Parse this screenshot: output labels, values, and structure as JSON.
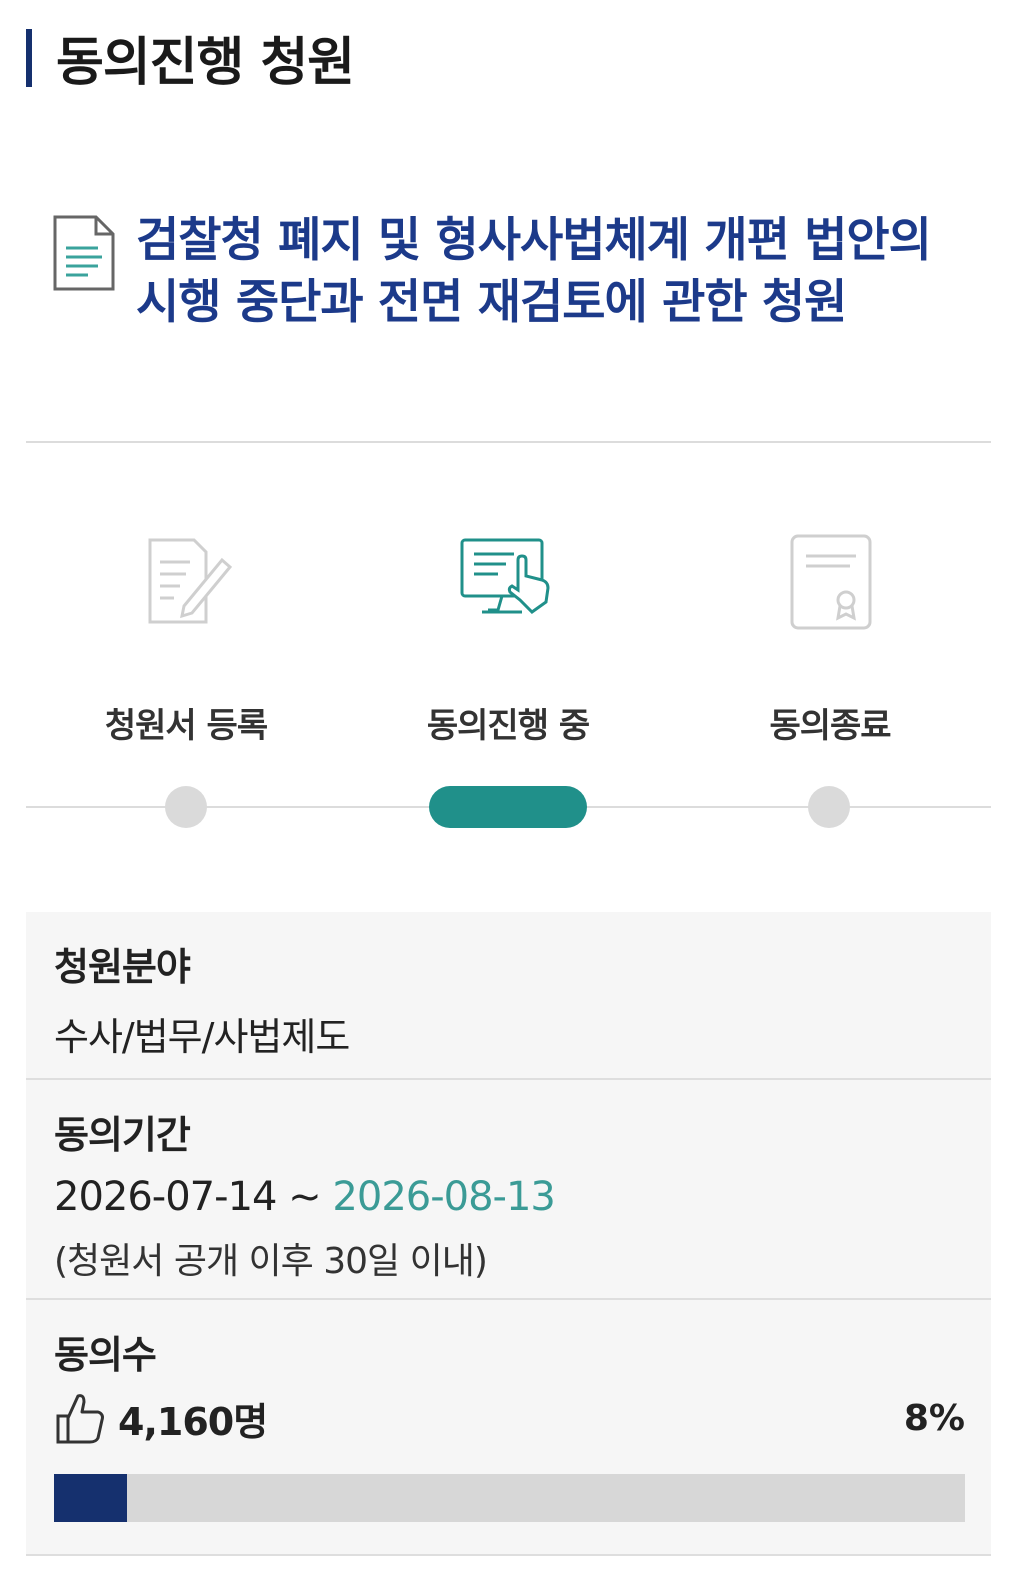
{
  "page": {
    "heading": "동의진행 청원"
  },
  "petition": {
    "title": "검찰청 폐지 및 형사사법체계 개편 법안의 시행 중단과 전면 재검토에 관한 청원"
  },
  "steps": [
    {
      "label": "청원서 등록",
      "icon": "document-edit-icon",
      "status": "done"
    },
    {
      "label": "동의진행 중",
      "icon": "monitor-touch-icon",
      "status": "current"
    },
    {
      "label": "동의종료",
      "icon": "certificate-icon",
      "status": "pending"
    }
  ],
  "colors": {
    "accent": "#20908a",
    "navy": "#15306e",
    "title_blue": "#1c3a8a"
  },
  "details": {
    "field": {
      "label": "청원분야",
      "value": "수사/법무/사법제도"
    },
    "period": {
      "label": "동의기간",
      "start": "2026-07-14",
      "separator": " ~ ",
      "end": "2026-08-13",
      "note": "(청원서 공개 이후 30일 이내)"
    },
    "count": {
      "label": "동의수",
      "value": "4,160명",
      "percent_text": "8%",
      "progress": 0.08
    }
  }
}
